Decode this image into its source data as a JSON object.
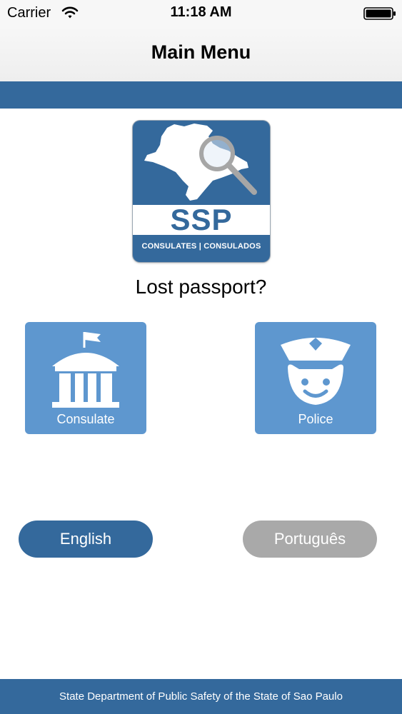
{
  "status_bar": {
    "carrier": "Carrier",
    "time": "11:18 AM",
    "icons": [
      "wifi-icon",
      "battery-icon"
    ]
  },
  "nav": {
    "title": "Main Menu"
  },
  "logo": {
    "brand": "SSP",
    "subtitle": "CONSULATES | CONSULADOS",
    "icons": [
      "sao-paulo-map-icon",
      "magnifier-icon"
    ]
  },
  "question": "Lost passport?",
  "tiles": [
    {
      "label": "Consulate",
      "icon": "building-flag-icon"
    },
    {
      "label": "Police",
      "icon": "police-officer-icon"
    }
  ],
  "language_buttons": [
    {
      "label": "English",
      "selected": true
    },
    {
      "label": "Português",
      "selected": false
    }
  ],
  "footer": {
    "text": "State Department of Public Safety of the State of Sao Paulo"
  },
  "colors": {
    "brand_blue": "#34699c",
    "tile_blue": "#5e97cf",
    "inactive_gray": "#a9a9a9",
    "white": "#ffffff"
  }
}
